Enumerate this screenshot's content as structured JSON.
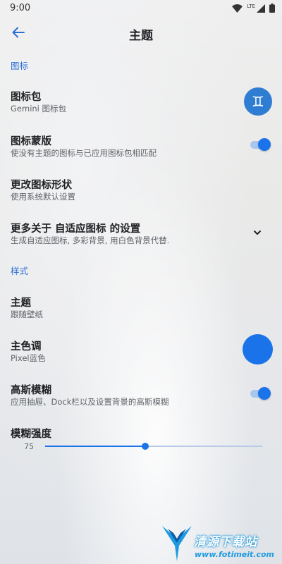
{
  "status_bar": {
    "time": "9:00",
    "network": "LTE"
  },
  "app_bar": {
    "title": "主题"
  },
  "sections": {
    "icons": "图标",
    "style": "样式"
  },
  "icon_pack": {
    "title": "图标包",
    "summary": "Gemini 图标包",
    "badge_glyph": "♊"
  },
  "icon_mask": {
    "title": "图标蒙版",
    "summary": "使没有主题的图标与已应用图标包相匹配",
    "enabled": true
  },
  "icon_shape": {
    "title": "更改图标形状",
    "summary": "使用系统默认设置"
  },
  "adaptive_icons": {
    "title": "更多关于 自适应图标 的设置",
    "summary": "生成自适应图标, 多彩背景, 用白色背景代替."
  },
  "theme": {
    "title": "主题",
    "summary": "跟随壁纸"
  },
  "accent_color": {
    "title": "主色调",
    "summary": "Pixel蓝色",
    "color": "#1a73e8"
  },
  "blur": {
    "title": "高斯模糊",
    "summary": "应用抽屉、Dock栏以及设置背景的高斯模糊",
    "enabled": true
  },
  "blur_strength": {
    "title": "模糊强度",
    "value": "75",
    "fraction": 0.46
  },
  "watermark": {
    "brand": "清源下载站",
    "url": "www.fotimeit.com"
  },
  "colors": {
    "accent": "#1a73e8",
    "section_header": "#2b6fd6"
  }
}
